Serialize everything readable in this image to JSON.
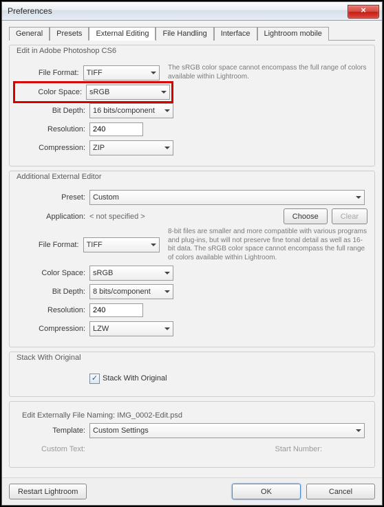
{
  "window": {
    "title": "Preferences"
  },
  "tabs": [
    "General",
    "Presets",
    "External Editing",
    "File Handling",
    "Interface",
    "Lightroom mobile"
  ],
  "active_tab": "External Editing",
  "section1": {
    "title": "Edit in Adobe Photoshop CS6",
    "fileFormat": {
      "label": "File Format:",
      "value": "TIFF"
    },
    "colorSpace": {
      "label": "Color Space:",
      "value": "sRGB"
    },
    "bitDepth": {
      "label": "Bit Depth:",
      "value": "16 bits/component"
    },
    "resolution": {
      "label": "Resolution:",
      "value": "240"
    },
    "compression": {
      "label": "Compression:",
      "value": "ZIP"
    },
    "hint": "The sRGB color space cannot encompass the full range of colors available within Lightroom."
  },
  "section2": {
    "title": "Additional External Editor",
    "preset": {
      "label": "Preset:",
      "value": "Custom"
    },
    "application": {
      "label": "Application:",
      "value": "< not specified >"
    },
    "choose": "Choose",
    "clear": "Clear",
    "fileFormat": {
      "label": "File Format:",
      "value": "TIFF"
    },
    "colorSpace": {
      "label": "Color Space:",
      "value": "sRGB"
    },
    "bitDepth": {
      "label": "Bit Depth:",
      "value": "8 bits/component"
    },
    "resolution": {
      "label": "Resolution:",
      "value": "240"
    },
    "compression": {
      "label": "Compression:",
      "value": "LZW"
    },
    "hint": "8-bit files are smaller and more compatible with various programs and plug-ins, but will not preserve fine tonal detail as well as 16-bit data. The sRGB color space cannot encompass the full range of colors available within Lightroom."
  },
  "section3": {
    "title": "Stack With Original",
    "checkbox": {
      "label": "Stack With Original",
      "checked": true
    }
  },
  "section4": {
    "title": "Edit Externally File Naming:",
    "example": "IMG_0002-Edit.psd",
    "template": {
      "label": "Template:",
      "value": "Custom Settings"
    },
    "customText": {
      "label": "Custom Text:"
    },
    "startNumber": {
      "label": "Start Number:"
    }
  },
  "footer": {
    "restart": "Restart Lightroom",
    "ok": "OK",
    "cancel": "Cancel"
  }
}
